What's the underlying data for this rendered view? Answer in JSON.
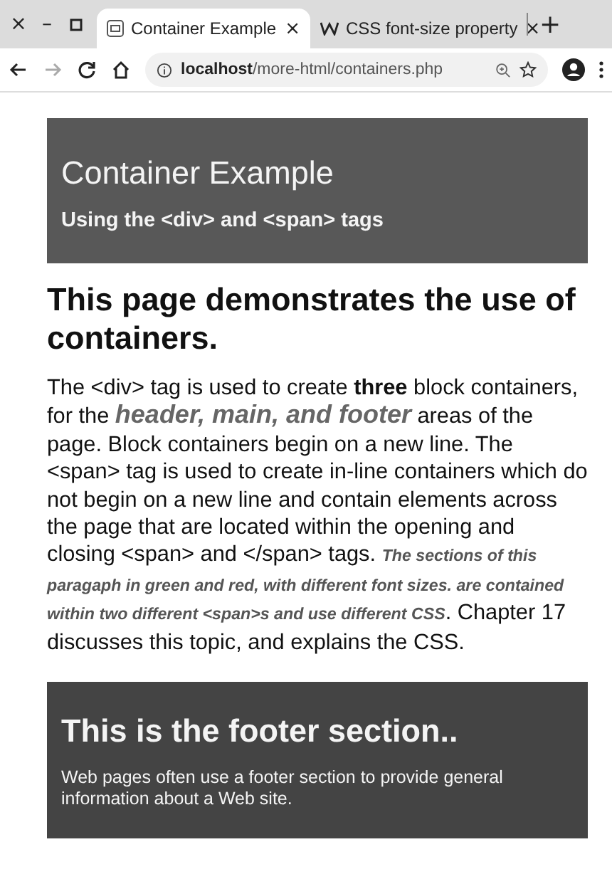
{
  "window_controls": [
    "×",
    "–"
  ],
  "tabs": [
    {
      "label": "Container Example",
      "selected": true,
      "close": "×",
      "kind": "page"
    },
    {
      "label": "CSS font-size property",
      "selected": false,
      "close": "×",
      "kind": "w"
    }
  ],
  "new_tab": "+",
  "address_bar": {
    "host": "localhost",
    "path": "/more-html/containers.php"
  },
  "page": {
    "header": {
      "title": "Container Example",
      "subtitle": "Using the <div> and <span> tags"
    },
    "heading": "This page demonstrates the use of containers.",
    "paragraph": [
      {
        "kind": "plain",
        "text": "The <div> tag is used to create "
      },
      {
        "kind": "bold",
        "text": "three"
      },
      {
        "kind": "plain",
        "text": " block containers, for the "
      },
      {
        "kind": "large",
        "text": "header, main, and footer"
      },
      {
        "kind": "plain",
        "text": " areas of the page. Block containers begin on a new line. The <span> tag is used to create in-line containers which do not begin on a new line and contain elements across the page that are located within the opening and closing <span> and </span> tags. "
      },
      {
        "kind": "small",
        "text": "The sections of this paragaph in green and red, with different font sizes. are contained within two different <span>s and use different CSS"
      },
      {
        "kind": "plain",
        "text": ". Chapter 17 discusses this topic, and explains the CSS."
      }
    ],
    "footer": {
      "title": "This is the footer section..",
      "text": "Web pages often use a footer section to provide general information about a Web site."
    }
  }
}
